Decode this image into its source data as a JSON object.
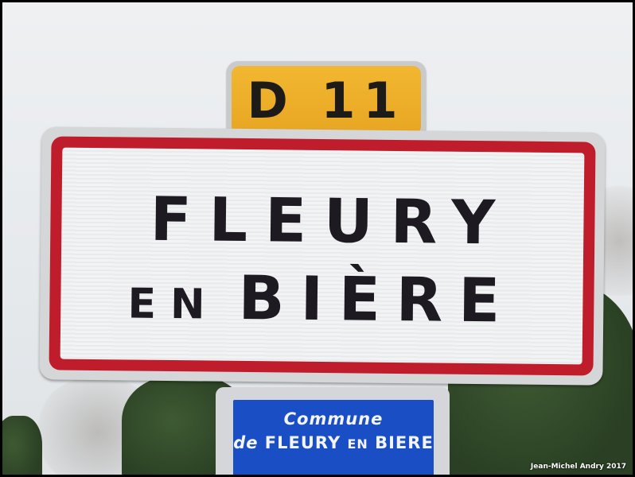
{
  "route_sign": {
    "label": "D 11",
    "color": "#e8a622"
  },
  "town_sign": {
    "line1": "FLEURY",
    "line2_prefix": "EN",
    "line2_main": "BIÈRE",
    "border_color": "#c01d2c"
  },
  "commune_sign": {
    "line1": "Commune",
    "line2_prefix": "de",
    "line2_name": "FLEURY",
    "line2_connector": "EN",
    "line2_suffix": "BIERE",
    "color": "#1a4ec4"
  },
  "credit": "Jean-Michel  Andry 2017"
}
